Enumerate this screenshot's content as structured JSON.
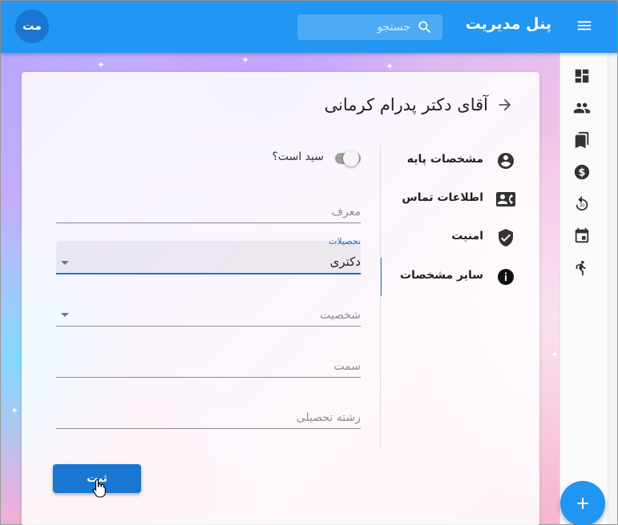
{
  "appbar": {
    "title": "پنل مدیریت",
    "search_placeholder": "جستجو",
    "avatar_initials": "مت",
    "color": "#2196f3"
  },
  "page": {
    "title": "آقای دکتر پدرام کرمانی"
  },
  "side_nav": {
    "items": [
      {
        "label": "مشخصات پایه",
        "icon": "account-circle-icon"
      },
      {
        "label": "اطلاعات تماس",
        "icon": "contact-card-icon"
      },
      {
        "label": "امنیت",
        "icon": "shield-check-icon"
      },
      {
        "label": "سایر مشخصات",
        "icon": "info-icon",
        "active": true
      }
    ]
  },
  "form": {
    "seed_label": "سید است؟",
    "seed_checked": false,
    "referrer_placeholder": "معرف",
    "education_label": "تحصیلات",
    "education_value": "دکتری",
    "personality_placeholder": "شخصیت",
    "position_placeholder": "سمت",
    "field_of_study_placeholder": "رشته تحصیلی",
    "submit_label": "ثبت"
  },
  "rail": {
    "icons": [
      "dashboard-icon",
      "people-icon",
      "bookmarks-icon",
      "dollar-icon",
      "replay-30-icon",
      "calendar-icon",
      "person-running-icon"
    ]
  },
  "fab": {
    "icon": "plus-icon"
  },
  "colors": {
    "primary": "#2196f3",
    "accent": "#1976d2"
  }
}
